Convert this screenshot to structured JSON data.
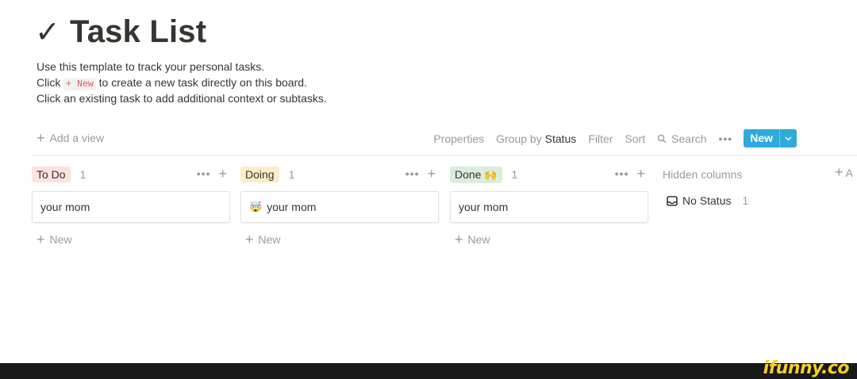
{
  "page": {
    "title": "Task List",
    "title_icon": "✓",
    "description": {
      "line1": "Use this template to track your personal tasks.",
      "line2_pre": "Click",
      "line2_code": "+ New",
      "line2_post": "to create a new task directly on this board.",
      "line3": "Click an existing task to add additional context or subtasks."
    }
  },
  "toolbar": {
    "add_view": "Add a view",
    "properties": "Properties",
    "group_by_label": "Group by",
    "group_by_value": "Status",
    "filter": "Filter",
    "sort": "Sort",
    "search": "Search",
    "more": "•••",
    "new": "New",
    "accent": "#2eaadc"
  },
  "board": {
    "columns": [
      {
        "label": "To Do",
        "count": "1",
        "color": "#ffe2dd",
        "card_title": "your mom",
        "card_emoji": "",
        "new_label": "New"
      },
      {
        "label": "Doing",
        "count": "1",
        "color": "#fdecc8",
        "card_title": "your mom",
        "card_emoji": "🤯",
        "new_label": "New"
      },
      {
        "label": "Done",
        "emoji": "🙌",
        "count": "1",
        "color": "#dbeddb",
        "card_title": "your mom",
        "card_emoji": "",
        "new_label": "New"
      }
    ],
    "hidden_columns_label": "Hidden columns",
    "no_status_label": "No Status",
    "no_status_count": "1",
    "add_group_label": "A"
  },
  "footer": {
    "brand": "ifunny.co"
  }
}
